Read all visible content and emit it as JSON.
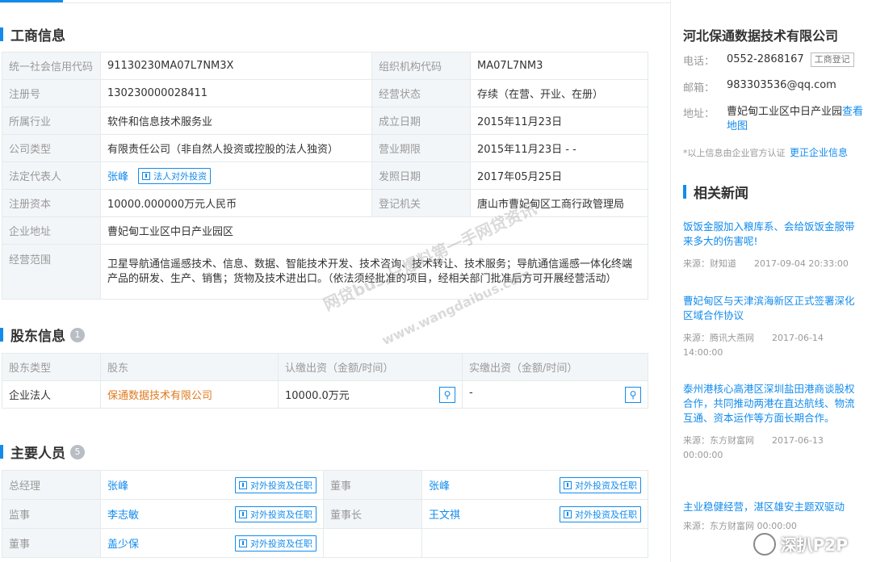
{
  "biz": {
    "title": "工商信息",
    "rows": [
      {
        "l1": "统一社会信用代码",
        "v1": "91130230MA07L7NM3X",
        "l2": "组织机构代码",
        "v2": "MA07L7NM3"
      },
      {
        "l1": "注册号",
        "v1": "130230000028411",
        "l2": "经营状态",
        "v2": "存续（在营、开业、在册）"
      },
      {
        "l1": "所属行业",
        "v1": "软件和信息技术服务业",
        "l2": "成立日期",
        "v2": "2015年11月23日"
      },
      {
        "l1": "公司类型",
        "v1": "有限责任公司（非自然人投资或控股的法人独资）",
        "l2": "营业期限",
        "v2": "2015年11月23日 - -"
      },
      {
        "l1": "法定代表人",
        "v1": "张峰",
        "btn": "法人对外投资",
        "l2": "发照日期",
        "v2": "2017年05月25日"
      },
      {
        "l1": "注册资本",
        "v1": "10000.000000万元人民币",
        "l2": "登记机关",
        "v2": "唐山市曹妃甸区工商行政管理局"
      },
      {
        "l1": "企业地址",
        "v1": "曹妃甸工业区中日产业园区"
      },
      {
        "l1": "经营范围",
        "v1": "卫星导航通信遥感技术、信息、数据、智能技术开发、技术咨询、技术转让、技术服务；导航通信遥感一体化终端产品的研发、生产、销售；货物及技术进出口。（依法须经批准的项目，经相关部门批准后方可开展经营活动）"
      }
    ]
  },
  "sh": {
    "title": "股东信息",
    "count": "1",
    "headers": [
      "股东类型",
      "股东",
      "认缴出资（金额/时间）",
      "实缴出资（金额/时间）"
    ],
    "row": {
      "type": "企业法人",
      "name": "保通数据技术有限公司",
      "sub": "10000.0万元",
      "paid": "-"
    }
  },
  "staff": {
    "title": "主要人员",
    "count": "5",
    "btn": "对外投资及任职",
    "rows": [
      {
        "r1": "总经理",
        "n1": "张峰",
        "r2": "董事",
        "n2": "张峰"
      },
      {
        "r1": "监事",
        "n1": "李志敏",
        "r2": "董事长",
        "n2": "王文祺"
      },
      {
        "r1": "董事",
        "n1": "盖少保"
      }
    ]
  },
  "side": {
    "company": "河北保通数据技术有限公司",
    "phone_label": "电话：",
    "phone": "0552-2868167",
    "phone_tag": "工商登记",
    "email_label": "邮箱：",
    "email": "983303536@qq.com",
    "addr_label": "地址：",
    "addr": "曹妃甸工业区中日产业园",
    "map_link": "查看地图",
    "note": "*以上信息由企业官方认证",
    "correct": "更正企业信息",
    "news_title": "相关新闻",
    "news": [
      {
        "t": "饭饭金服加入粮库系、会给饭饭金服带来多大的伤害呢!",
        "m": "来源：财知道　　2017-09-04 20:33:00"
      },
      {
        "t": "曹妃甸区与天津滨海新区正式签署深化区域合作协议",
        "m": "来源：腾讯大燕网　　2017-06-14 14:00:00"
      },
      {
        "t": "泰州港核心高港区深圳盐田港商谈股权合作，共同推动两港在直达航线、物流互通、资本运作等方面长期合作。",
        "m": "来源：东方财富网　　2017-06-13 00:00:00"
      },
      {
        "t": "主业稳健经营，湛区雄安主题双驱动",
        "m": "来源：东方财富网 00:00:00"
      }
    ]
  },
  "watermark": {
    "line1": "网贷bus,只爆料第一手网贷资讯",
    "line2": "www.wangdaibus.com",
    "badge": "深扒P2P"
  }
}
